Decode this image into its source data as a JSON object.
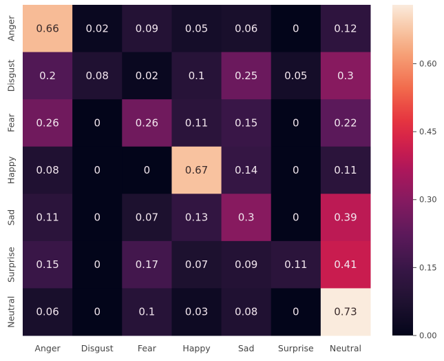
{
  "chart_data": {
    "type": "heatmap",
    "title": "",
    "xlabel": "",
    "ylabel": "",
    "x_categories": [
      "Anger",
      "Disgust",
      "Fear",
      "Happy",
      "Sad",
      "Surprise",
      "Neutral"
    ],
    "y_categories": [
      "Anger",
      "Disgust",
      "Fear",
      "Happy",
      "Sad",
      "Surprise",
      "Neutral"
    ],
    "values": [
      [
        0.66,
        0.02,
        0.09,
        0.05,
        0.06,
        0,
        0.12
      ],
      [
        0.2,
        0.08,
        0.02,
        0.1,
        0.25,
        0.05,
        0.3
      ],
      [
        0.26,
        0,
        0.26,
        0.11,
        0.15,
        0,
        0.22
      ],
      [
        0.08,
        0,
        0,
        0.67,
        0.14,
        0,
        0.11
      ],
      [
        0.11,
        0,
        0.07,
        0.13,
        0.3,
        0,
        0.39
      ],
      [
        0.15,
        0,
        0.17,
        0.07,
        0.09,
        0.11,
        0.41
      ],
      [
        0.06,
        0,
        0.1,
        0.03,
        0.08,
        0,
        0.73
      ]
    ],
    "colormap": "rocket",
    "colorbar": {
      "range": [
        0,
        0.73
      ],
      "ticks": [
        0.0,
        0.15,
        0.3,
        0.45,
        0.6
      ],
      "tick_labels": [
        "0.00",
        "0.15",
        "0.30",
        "0.45",
        "0.60"
      ],
      "placement": "right"
    },
    "annotations": true,
    "grid": false
  }
}
